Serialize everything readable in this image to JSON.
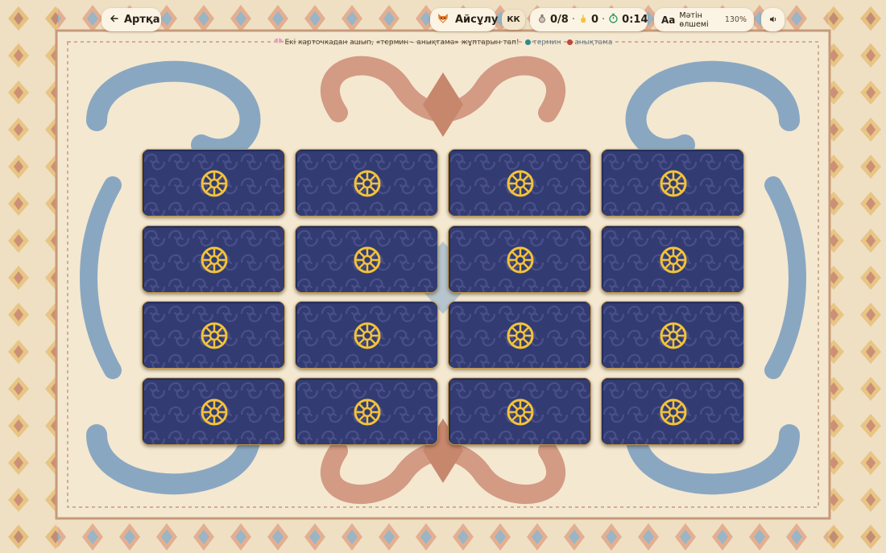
{
  "header": {
    "back_label": "Артқа",
    "player_name": "Айсұлу",
    "language": "КК",
    "pairs_found": "0/8",
    "moves": "0",
    "timer": "0:14",
    "text_size_icon": "Aa",
    "text_size_label": "Мәтін өлшемі",
    "text_size_value": "130%"
  },
  "hint": {
    "text": "Екі карточкадан ашып, «термин – анықтама» жұптарын тап!",
    "legend_term": "термин",
    "legend_definition": "анықтама"
  },
  "colors": {
    "term": "#2e8a8a",
    "definition": "#c0463c",
    "card_back": "#2f3a6e",
    "card_border": "#c89a3c",
    "emblem": "#f2c23a"
  },
  "icons": [
    "arrow-left-icon",
    "fox-avatar-icon",
    "potion-icon",
    "hand-icon",
    "stopwatch-icon",
    "speaker-icon",
    "sun-wheel-icon"
  ],
  "cards": [
    {
      "id": 1,
      "state": "face-down"
    },
    {
      "id": 2,
      "state": "face-down"
    },
    {
      "id": 3,
      "state": "face-down"
    },
    {
      "id": 4,
      "state": "face-down"
    },
    {
      "id": 5,
      "state": "face-down"
    },
    {
      "id": 6,
      "state": "face-down"
    },
    {
      "id": 7,
      "state": "face-down"
    },
    {
      "id": 8,
      "state": "face-down"
    },
    {
      "id": 9,
      "state": "face-down"
    },
    {
      "id": 10,
      "state": "face-down"
    },
    {
      "id": 11,
      "state": "face-down"
    },
    {
      "id": 12,
      "state": "face-down"
    },
    {
      "id": 13,
      "state": "face-down"
    },
    {
      "id": 14,
      "state": "face-down"
    },
    {
      "id": 15,
      "state": "face-down"
    },
    {
      "id": 16,
      "state": "face-down"
    }
  ]
}
